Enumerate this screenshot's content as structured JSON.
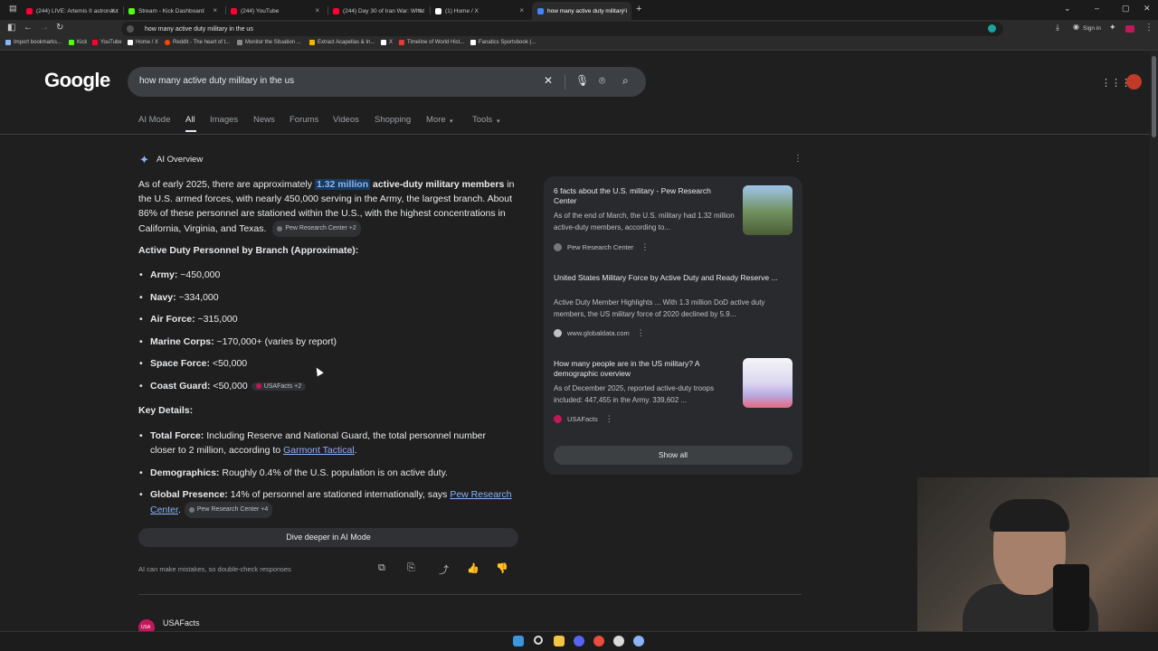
{
  "browser": {
    "tabs": [
      {
        "label": "(244) LIVE: Artemis II astronaut",
        "color": "#ff0033"
      },
      {
        "label": "Stream - Kick Dashboard",
        "color": "#53fc18"
      },
      {
        "label": "(244) YouTube",
        "color": "#ff0033"
      },
      {
        "label": "(244) Day 30 of Iran War: What",
        "color": "#ff0033"
      },
      {
        "label": "(1) Home / X",
        "color": "#ffffff"
      },
      {
        "label": "how many active duty military i",
        "color": "#4285f4"
      }
    ],
    "new_tab": "+",
    "address": "how many active duty military in the us",
    "signin": "Sign in",
    "bookmarks": [
      {
        "label": "Import bookmarks...",
        "color": "#8ab4f8"
      },
      {
        "label": "Kick",
        "color": "#53fc18"
      },
      {
        "label": "YouTube",
        "color": "#ff0033"
      },
      {
        "label": "Home / X",
        "color": "#ffffff"
      },
      {
        "label": "Reddit - The heart of t...",
        "color": "#ff4500"
      },
      {
        "label": "Monitor the Situation ...",
        "color": "#888888"
      },
      {
        "label": "Extract Acapellas & In...",
        "color": "#f4b400"
      },
      {
        "label": "X",
        "color": "#ffffff"
      },
      {
        "label": "Timeline of World Hist...",
        "color": "#e53935"
      },
      {
        "label": "Fanatics Sportsbook (...",
        "color": "#ffffff"
      }
    ]
  },
  "google": {
    "logo": "Google",
    "query": "how many active duty military in the us",
    "tabs": [
      "AI Mode",
      "All",
      "Images",
      "News",
      "Forums",
      "Videos",
      "Shopping",
      "More",
      "Tools"
    ]
  },
  "ai_overview": {
    "title": "AI Overview",
    "lead_1": "As of early 2025, there are approximately ",
    "lead_hl": "1.32 million",
    "lead_bold": " active-duty military members",
    "lead_2": " in the U.S. armed forces, with nearly 450,000 serving in the Army, the largest branch. About 86% of these personnel are stationed within the U.S., with the highest concentrations in California, Virginia, and Texas.",
    "lead_chip": "Pew Research Center +2",
    "branch_heading": "Active Duty Personnel by Branch (Approximate):",
    "branches": [
      {
        "name": "Army:",
        "value": " ~450,000"
      },
      {
        "name": "Navy:",
        "value": " ~334,000"
      },
      {
        "name": "Air Force:",
        "value": " ~315,000"
      },
      {
        "name": "Marine Corps:",
        "value": " ~170,000+ (varies by report)"
      },
      {
        "name": "Space Force:",
        "value": " <50,000"
      },
      {
        "name": "Coast Guard:",
        "value": " <50,000"
      }
    ],
    "coast_chip": "USAFacts +2",
    "key_heading": "Key Details:",
    "total_label": "Total Force:",
    "total_text": " Including Reserve and National Guard, the total personnel number closer to 2 million, according to ",
    "total_link": "Garmont Tactical",
    "total_end": ".",
    "demo_label": "Demographics:",
    "demo_text": " Roughly 0.4% of the U.S. population is on active duty.",
    "global_label": "Global Presence:",
    "global_text": " 14% of personnel are stationed internationally, says ",
    "global_link": "Pew Research Center",
    "global_end": ".",
    "global_chip": "Pew Research Center +4",
    "dive_button": "Dive deeper in AI Mode",
    "disclaimer": "AI can make mistakes, so double-check responses"
  },
  "sources": [
    {
      "title": "6 facts about the U.S. military - Pew Research Center",
      "snippet": "As of the end of March, the U.S. military had 1.32 million active-duty members, according to...",
      "site": "Pew Research Center"
    },
    {
      "title": "United States Military Force by Active Duty and Ready Reserve ...",
      "snippet": "Active Duty Member Highlights ... With 1.3 million DoD active duty members, the US military force of 2020 declined by 5.9...",
      "site": "www.globaldata.com"
    },
    {
      "title": "How many people are in the US military? A demographic overview",
      "snippet": "As of December 2025, reported active-duty troops included: 447,455 in the Army. 339,602 ...",
      "site": "USAFacts"
    }
  ],
  "show_all": "Show all",
  "next_result": {
    "site": "USAFacts",
    "icon_text": "USA"
  }
}
